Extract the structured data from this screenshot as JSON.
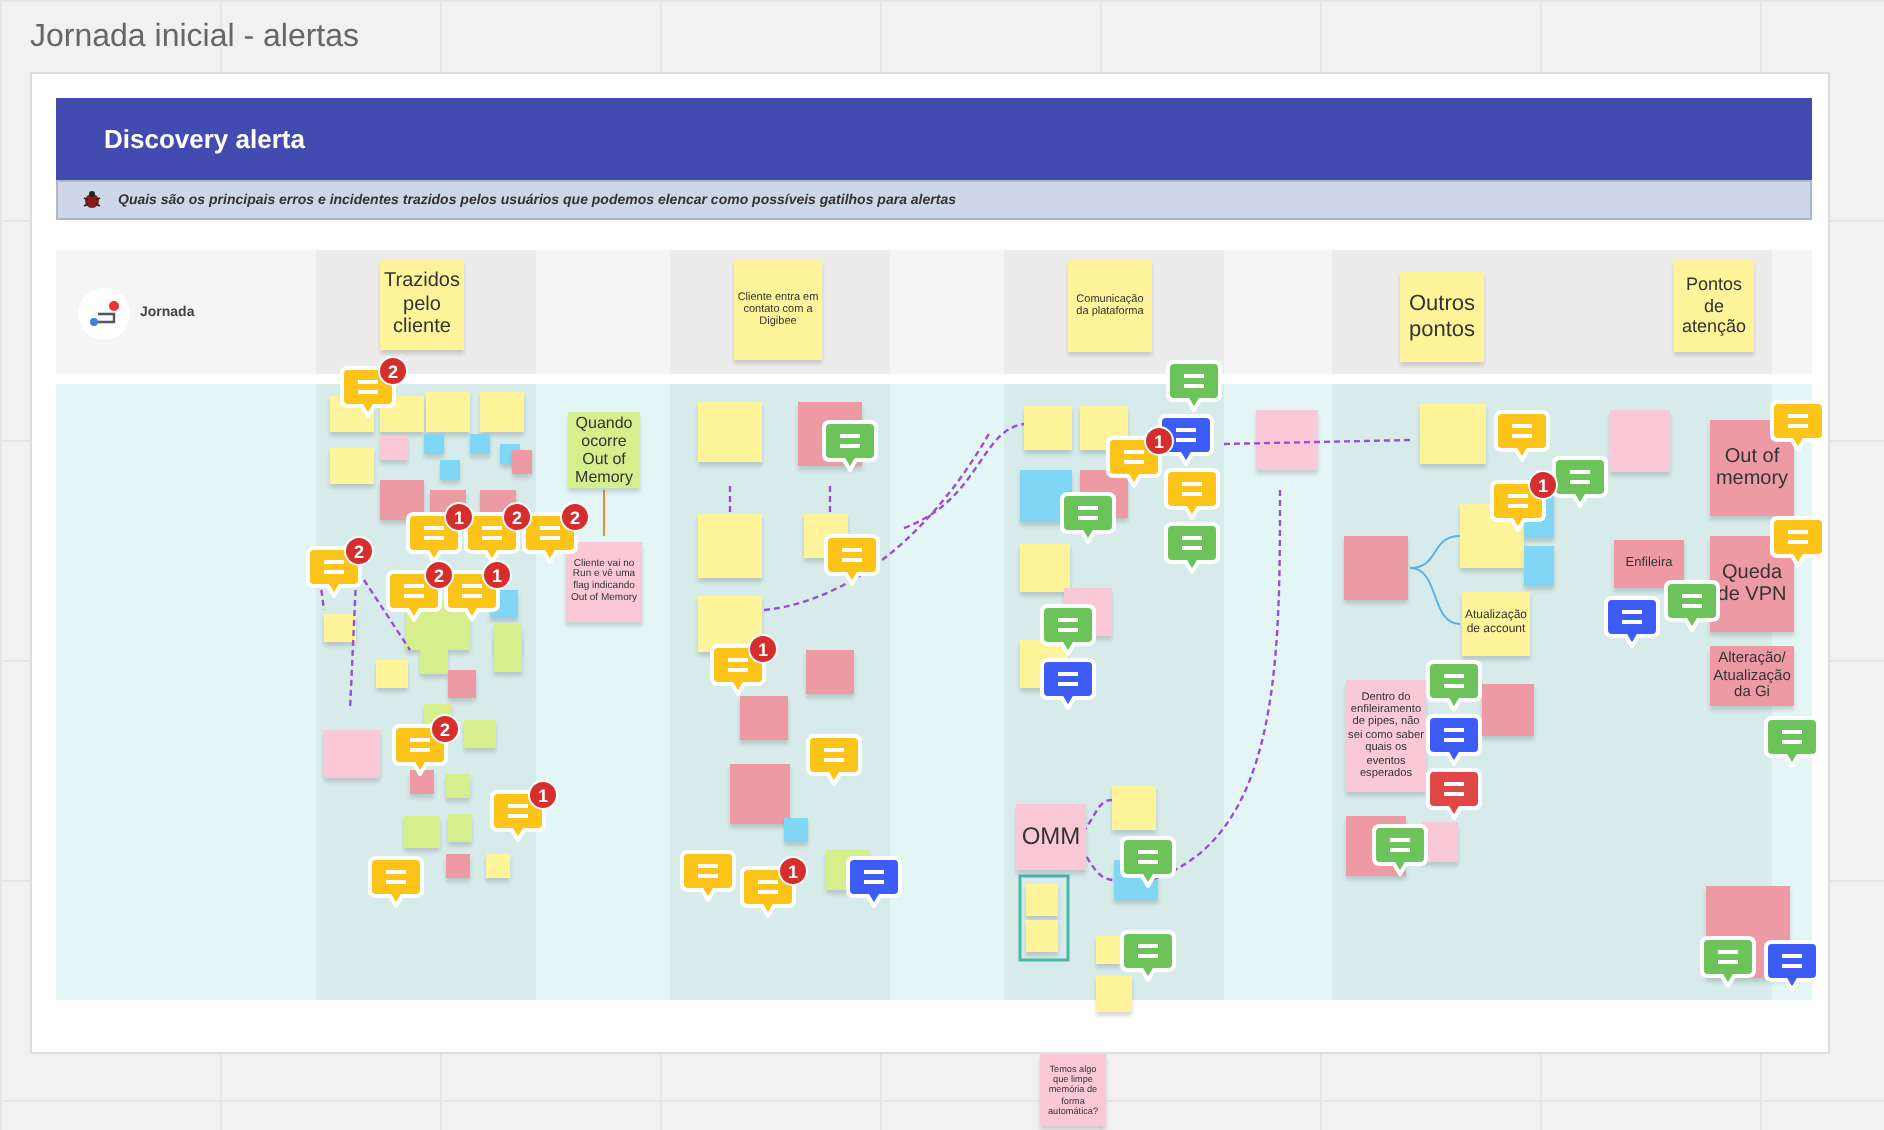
{
  "board": {
    "title": "Jornada inicial - alertas"
  },
  "frame": {
    "title": "Discovery alerta",
    "question": "Quais são os principais erros e incidentes trazidos pelos usuários que podemos elencar como possíveis gatilhos para alertas"
  },
  "lane": {
    "label": "Jornada"
  },
  "columns": [
    {
      "label": "Trazidos pelo cliente"
    },
    {
      "label": "Cliente entra em contato com a Digibee"
    },
    {
      "label": "Comunicação da plataforma"
    },
    {
      "label": "Outros pontos"
    },
    {
      "label": "Pontos de atenção"
    }
  ],
  "notes": [
    {
      "text": "Quando ocorre Out of Memory",
      "color": "#d6ef8d"
    },
    {
      "text": "Cliente vai no Run e vê uma flag indicando Out of Memory",
      "color": "#fbc8d8"
    },
    {
      "text": "OMM",
      "color": "#fbc8d8"
    },
    {
      "text": "Temos algo que limpe memória de forma automática?",
      "color": "#fbc8d8"
    },
    {
      "text": "Atualização de account",
      "color": "#fff49a"
    },
    {
      "text": "Dentro do enfileiramento de pipes, não sei como saber quais os eventos esperados",
      "color": "#fbc8d8"
    },
    {
      "text": "Out of memory",
      "color": "#ee9aa5"
    },
    {
      "text": "Queda de VPN",
      "color": "#ee9aa5"
    },
    {
      "text": "Alteração/ Atualização da Gi",
      "color": "#ee9aa5"
    },
    {
      "text": "Enfileira",
      "color": "#ee9aa5"
    }
  ],
  "comments": [
    {
      "color": "#fcc419",
      "count": "2"
    },
    {
      "color": "#fcc419",
      "count": "1"
    },
    {
      "color": "#fcc419",
      "count": "2"
    },
    {
      "color": "#fcc419",
      "count": "2"
    },
    {
      "color": "#fcc419",
      "count": "2"
    },
    {
      "color": "#fcc419",
      "count": "2"
    },
    {
      "color": "#fcc419",
      "count": "1"
    },
    {
      "color": "#fcc419",
      "count": "2"
    },
    {
      "color": "#fcc419",
      "count": "1"
    },
    {
      "color": "#fcc419"
    },
    {
      "color": "#6cc35a"
    },
    {
      "color": "#fcc419"
    },
    {
      "color": "#fcc419",
      "count": "1"
    },
    {
      "color": "#fcc419"
    },
    {
      "color": "#fcc419"
    },
    {
      "color": "#fcc419",
      "count": "1"
    },
    {
      "color": "#3d5cf5"
    },
    {
      "color": "#6cc35a"
    },
    {
      "color": "#3d5cf5"
    },
    {
      "color": "#fcc419",
      "count": "1"
    },
    {
      "color": "#fcc419"
    },
    {
      "color": "#6cc35a"
    },
    {
      "color": "#6cc35a"
    },
    {
      "color": "#3d5cf5"
    },
    {
      "color": "#6cc35a"
    },
    {
      "color": "#6cc35a"
    },
    {
      "color": "#6cc35a"
    },
    {
      "color": "#fcc419"
    },
    {
      "color": "#6cc35a"
    },
    {
      "color": "#fcc419",
      "count": "1"
    },
    {
      "color": "#6cc35a"
    },
    {
      "color": "#3d5cf5"
    },
    {
      "color": "#e04848"
    },
    {
      "color": "#6cc35a"
    },
    {
      "color": "#3d5cf5"
    },
    {
      "color": "#6cc35a"
    },
    {
      "color": "#fcc419"
    },
    {
      "color": "#fcc419"
    },
    {
      "color": "#6cc35a"
    },
    {
      "color": "#6cc35a"
    },
    {
      "color": "#3d5cf5"
    }
  ]
}
